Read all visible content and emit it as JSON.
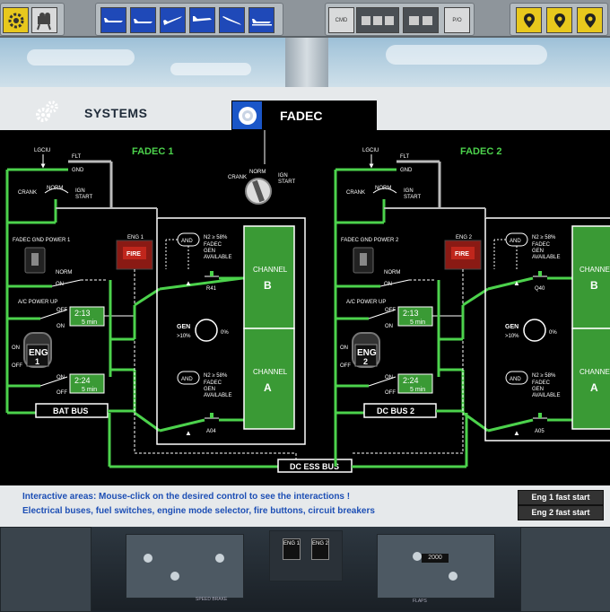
{
  "toolbar": {
    "left_icons": [
      "gears-icon",
      "projector-icon"
    ],
    "phase_icons": [
      "aircraft-parked-icon",
      "aircraft-taxi-icon",
      "aircraft-takeoff-icon",
      "aircraft-cruise-icon",
      "aircraft-descent-icon",
      "aircraft-landing-icon"
    ],
    "panels": [
      "CMD",
      "",
      "",
      "P/O"
    ],
    "right_icons": [
      "map-pin-1-icon",
      "map-pin-2-icon",
      "map-pin-3-icon"
    ]
  },
  "header": {
    "systems_label": "SYSTEMS",
    "tab_label": "FADEC"
  },
  "schematic": {
    "fadec1_title": "FADEC 1",
    "fadec2_title": "FADEC 2",
    "lgciu": "LGCIU",
    "flt": "FLT",
    "gnd": "GND",
    "crank": "CRANK",
    "norm": "NORM",
    "ign": "IGN",
    "start": "START",
    "fadec_gnd_power_1": "FADEC GND POWER 1",
    "fadec_gnd_power_2": "FADEC GND POWER 2",
    "on": "ON",
    "off": "OFF",
    "ac_power_up": "A/C POWER UP",
    "timer1": "2:13",
    "timer2": "2:24",
    "timer3": "2:13",
    "timer4": "2:24",
    "five_min": "5 min",
    "eng1_fire": "ENG 1",
    "eng2_fire": "ENG 2",
    "fire": "FIRE",
    "eng_switch_line1": "ENG",
    "eng1_switch_line2": "1",
    "eng2_switch_line2": "2",
    "bat_bus": "BAT BUS",
    "dc_bus_2": "DC BUS 2",
    "dc_ess_bus": "DC ESS BUS",
    "and": "AND",
    "n2_cond": "N2 ≥ 58%",
    "fadec_gen": "FADEC",
    "gen_word": "GEN",
    "available": "AVAILABLE",
    "gen": "GEN",
    "gen_cond": ">10%",
    "zero_pct": "0%",
    "channel": "CHANNEL",
    "channel_b": "B",
    "channel_a": "A",
    "cb_r41": "R41",
    "cb_a04": "A04",
    "cb_q40": "Q40",
    "cb_a05": "A05",
    "mode_crank": "CRANK",
    "mode_norm": "NORM",
    "mode_ign": "IGN",
    "mode_start": "START"
  },
  "info": {
    "line1": "Interactive areas: Mouse-click on the desired control to see the interactions !",
    "line2": "Electrical buses, fuel switches, engine mode selector, fire buttons, circuit breakers",
    "eng1_fast_start": "Eng 1 fast start",
    "eng2_fast_start": "Eng 2 fast start"
  },
  "pedestal": {
    "eng1_label": "ENG 1",
    "eng2_label": "ENG 2",
    "speed_brake": "SPEED BRAKE",
    "flaps": "FLAPS",
    "counter": "2000"
  },
  "colors": {
    "bus_green": "#3cc23c",
    "channel_green": "#3a9a35",
    "info_blue": "#1d4fb5"
  }
}
